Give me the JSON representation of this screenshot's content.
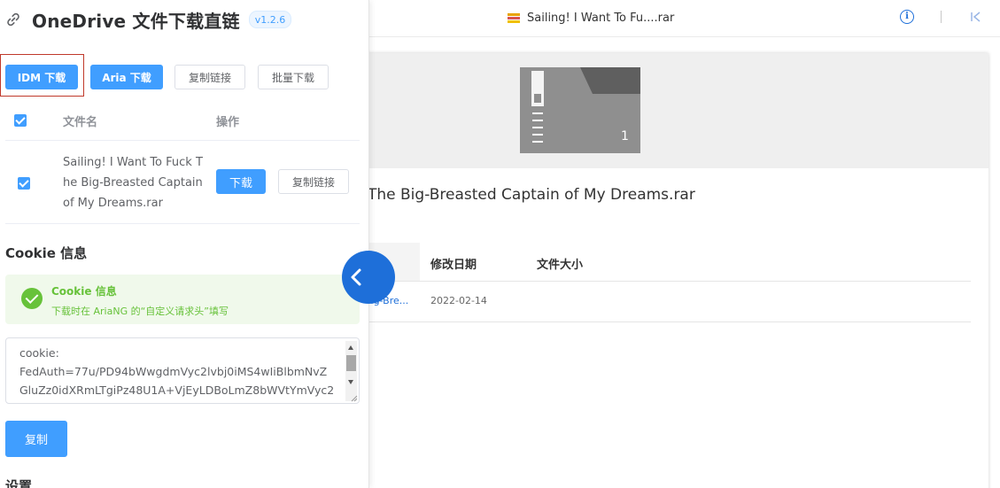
{
  "viewer": {
    "tab_title": "Sailing! I Want To Fu....rar",
    "icons": [
      "rar-file-icon",
      "info-icon",
      "skip-to-start-icon",
      "zip-archive-icon"
    ],
    "archive_count": "1",
    "file_title": "The Big-Breasted Captain of My Dreams.rar",
    "table": {
      "columns": [
        "修改日期",
        "文件大小"
      ],
      "rows": [
        {
          "name": "Big-Bre...",
          "modified": "2022-02-14",
          "size": ""
        }
      ]
    }
  },
  "panel": {
    "title": "OneDrive 文件下载直链",
    "version": "v1.2.6",
    "icons": [
      "link-icon",
      "collapse-chevron-icon"
    ],
    "actions": {
      "idm": "IDM 下载",
      "aria": "Aria 下载",
      "copy_links": "复制链接",
      "batch_download": "批量下载"
    },
    "file_table": {
      "col_name": "文件名",
      "col_action": "操作",
      "rows": [
        {
          "name": "Sailing! I Want To Fuck The Big-Breasted Captain of My Dreams.rar",
          "download": "下载",
          "copy": "复制链接",
          "checked": true
        }
      ]
    },
    "cookie_section": {
      "title": "Cookie 信息",
      "alert_title": "Cookie 信息",
      "alert_desc": "下载时在 AriaNG 的“自定义请求头”填写",
      "cookie_value": "cookie:\nFedAuth=77u/PD94bWwgdmVyc2lvbj0iMS4wIiBlbmNvZ\nGluZz0idXRmLTgiPz48U1A+VjEyLDBoLmZ8bWVtYmVyc2",
      "copy_button": "复制"
    },
    "settings_title": "设置"
  },
  "colors": {
    "primary": "#409eff",
    "success": "#67c23a",
    "success_bg": "#f0f9eb",
    "viewer_accent": "#1e6fd9"
  }
}
